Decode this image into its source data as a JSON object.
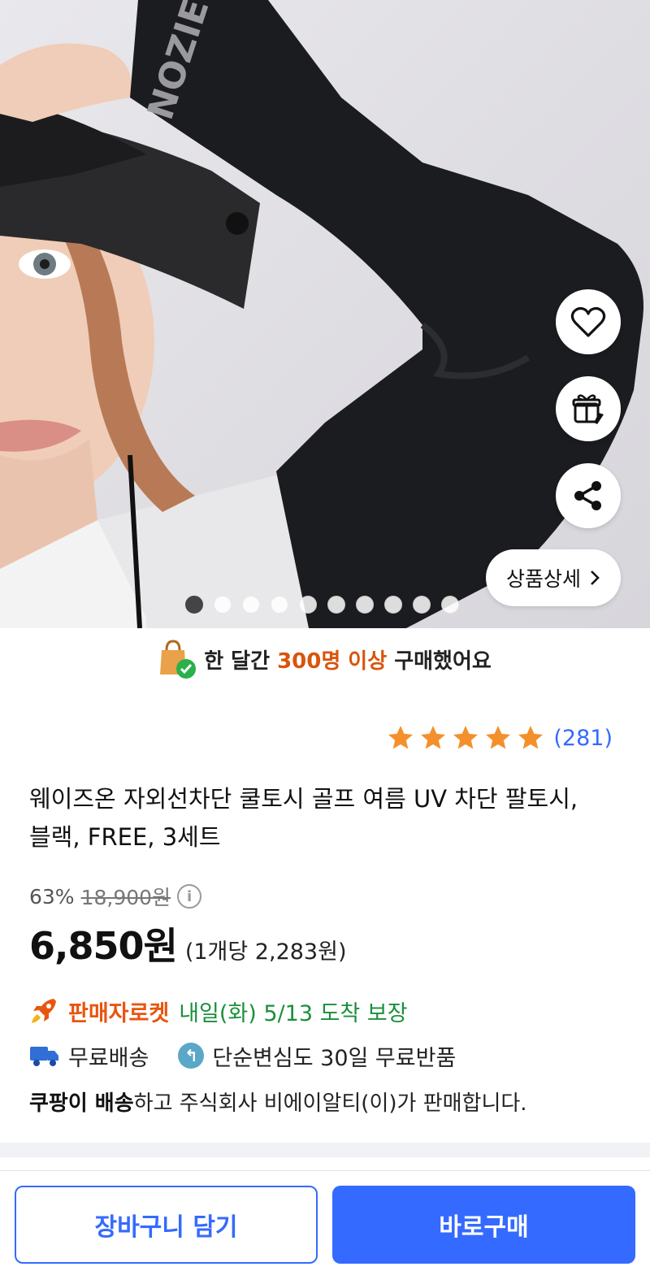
{
  "hero": {
    "brand_text_on_sleeve": "NOZIEW",
    "detail_button_label": "상품상세",
    "carousel_total": 10,
    "carousel_active_index": 1
  },
  "banner": {
    "prefix": "한 달간 ",
    "highlight": "300명 이상",
    "suffix": " 구매했어요",
    "highlight_color": "#d9540b"
  },
  "rating": {
    "stars": 5,
    "count": "(281)",
    "star_color": "#f4902b"
  },
  "product": {
    "title": "웨이즈온 자외선차단 쿨토시 골프 여름 UV 차단 팔토시, 블랙, FREE, 3세트",
    "discount_rate": "63%",
    "original_price": "18,900원",
    "price": "6,850원",
    "unit_price": "(1개당 2,283원)"
  },
  "delivery": {
    "rocket_label": "판매자로켓",
    "arrival": "내일(화) 5/13 도착 보장",
    "free_shipping": "무료배송",
    "free_return": "단순변심도 30일 무료반품",
    "seller_bold": "쿠팡이 배송",
    "seller_rest": "하고 주식회사 비에이알티(이)가 판매합니다."
  },
  "actions": {
    "cart_label": "장바구니 담기",
    "buy_label": "바로구매",
    "accent_color": "#346aff"
  }
}
